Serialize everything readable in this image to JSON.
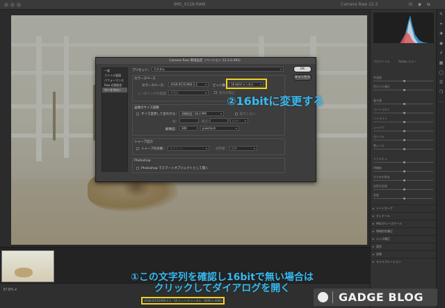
{
  "window": {
    "filename": "IMG_0128.RAW",
    "app_title": "Camera Raw 12.3",
    "toolbar_icons": "⊡ ◉ ⇆"
  },
  "bottom": {
    "zoom": "37.6% ▾",
    "workflow_link": "sRGB IEC61966-2.1 - 16 ビット/チャンネル - 6000 x 4000 (24.0MP) - 300 ppi"
  },
  "panel": {
    "profile_label": "プロファイル",
    "profile_value": "Adobe カラー",
    "sections": [
      "トーンカーブ",
      "ディテール",
      "HSL/グレースケール",
      "明暗別色補正",
      "レンズ補正",
      "変形",
      "効果",
      "キャリブレーション"
    ],
    "slider_labels": [
      "色温度",
      "色かぶり補正",
      "露光量",
      "コントラスト",
      "ハイライト",
      "シャドウ",
      "白レベル",
      "黒レベル",
      "テクスチャ",
      "明瞭度",
      "かすみの除去",
      "自然な彩度",
      "彩度"
    ]
  },
  "dialog": {
    "title": "Camera Raw 環境設定（バージョン 12.3.0.493）",
    "sidebar": [
      "一般",
      "ファイル管理",
      "パフォーマンス",
      "Raw 初期設定",
      "ワークフロー"
    ],
    "preset_label": "プリセット：",
    "preset_value": "カスタム",
    "colorspace_section": "カラースペース",
    "colorspace_label": "カラースペース：",
    "colorspace_value": "sRGB IEC61966-2.1",
    "bitdepth_label": "ビット数：",
    "bitdepth_value": "16 bit/チャンネル",
    "intent_label": "レンダリングの意図：",
    "intent_value": "知覚的",
    "blackpoint_label": "黒点の補正",
    "resize_section": "画像のサイズ調整",
    "resize_check_label": "サイズ変更して合わせる：",
    "resize_value": "初期設定 (18.4 MP)",
    "enlarge_label": "拡大しない",
    "width_label": "幅：",
    "height_label": "高さ：",
    "unit_value": "pixel",
    "resolution_label": "解像度：",
    "resolution_value": "300",
    "resolution_unit": "pixel/inch",
    "sharpen_section": "シャープ出力",
    "sharpen_label": "シャープの対象：",
    "sharpen_value": "スクリーン",
    "amount_label": "適用量：",
    "amount_value": "標準",
    "ps_section": "Photoshop",
    "ps_option": "Photoshop でスマートオブジェクトとして開く",
    "ok_label": "OK",
    "cancel_label": "キャンセル"
  },
  "annotations": {
    "step2": "②16bitに変更する",
    "step1_line1": "①この文字列を確認し16bitで無い場合は",
    "step1_line2": "クリックしてダイアログを開く"
  },
  "brand": {
    "name": "GADGE BLOG"
  },
  "colors": {
    "annotation": "#38b9f0",
    "highlight": "#f2d423",
    "dialog_bg": "#3d3d3d"
  }
}
